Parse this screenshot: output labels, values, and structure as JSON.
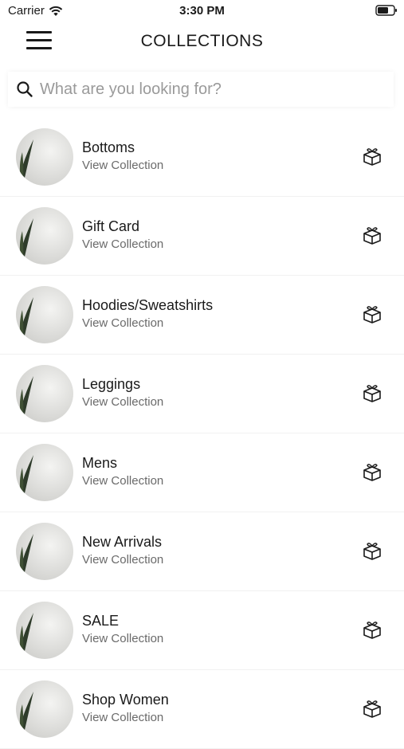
{
  "status_bar": {
    "carrier": "Carrier",
    "time": "3:30 PM"
  },
  "header": {
    "title": "COLLECTIONS",
    "menu_icon": "hamburger-menu-icon"
  },
  "search": {
    "placeholder": "What are you looking for?",
    "value": "",
    "icon": "search-icon"
  },
  "collections": [
    {
      "title": "Bottoms",
      "subtitle": "View Collection"
    },
    {
      "title": "Gift Card",
      "subtitle": "View Collection"
    },
    {
      "title": "Hoodies/Sweatshirts",
      "subtitle": "View Collection"
    },
    {
      "title": "Leggings",
      "subtitle": "View Collection"
    },
    {
      "title": "Mens",
      "subtitle": "View Collection"
    },
    {
      "title": "New Arrivals",
      "subtitle": "View Collection"
    },
    {
      "title": "SALE",
      "subtitle": "View Collection"
    },
    {
      "title": "Shop Women",
      "subtitle": "View Collection"
    }
  ],
  "row_icon": "gift-box-icon",
  "colors": {
    "text": "#1a1a1a",
    "subtext": "#6a6a6a",
    "placeholder": "#9a9a9a",
    "background": "#ffffff"
  }
}
